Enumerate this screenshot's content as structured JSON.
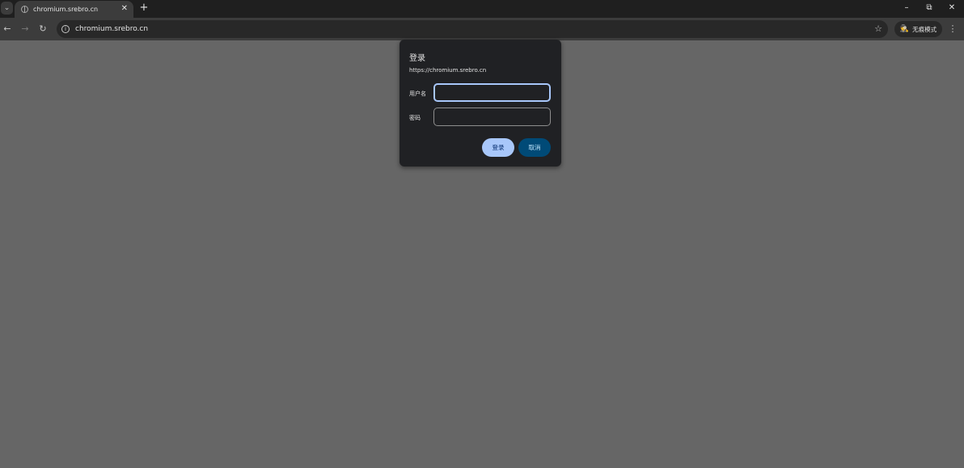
{
  "browser": {
    "tab": {
      "title": "chromium.srebro.cn",
      "favicon": "globe-icon"
    },
    "new_tab_glyph": "+",
    "window_controls": {
      "minimize": "–",
      "restore": "⧉",
      "close": "✕"
    },
    "nav": {
      "back": "←",
      "forward": "→",
      "reload": "↻"
    },
    "omnibox": {
      "url": "chromium.srebro.cn",
      "info_glyph": "i",
      "star_glyph": "☆"
    },
    "incognito": {
      "label": "无痕模式",
      "icon_glyph": "🕵"
    },
    "menu_glyph": "⋮",
    "tab_search_glyph": "⌄"
  },
  "dialog": {
    "title": "登录",
    "origin": "https://chromium.srebro.cn",
    "username_label": "用户名",
    "username_value": "",
    "password_label": "密码",
    "password_value": "",
    "login_button": "登录",
    "cancel_button": "取消"
  },
  "colors": {
    "page_background": "#666666",
    "accent": "#a8c7fa",
    "secondary_button": "#004a77"
  }
}
